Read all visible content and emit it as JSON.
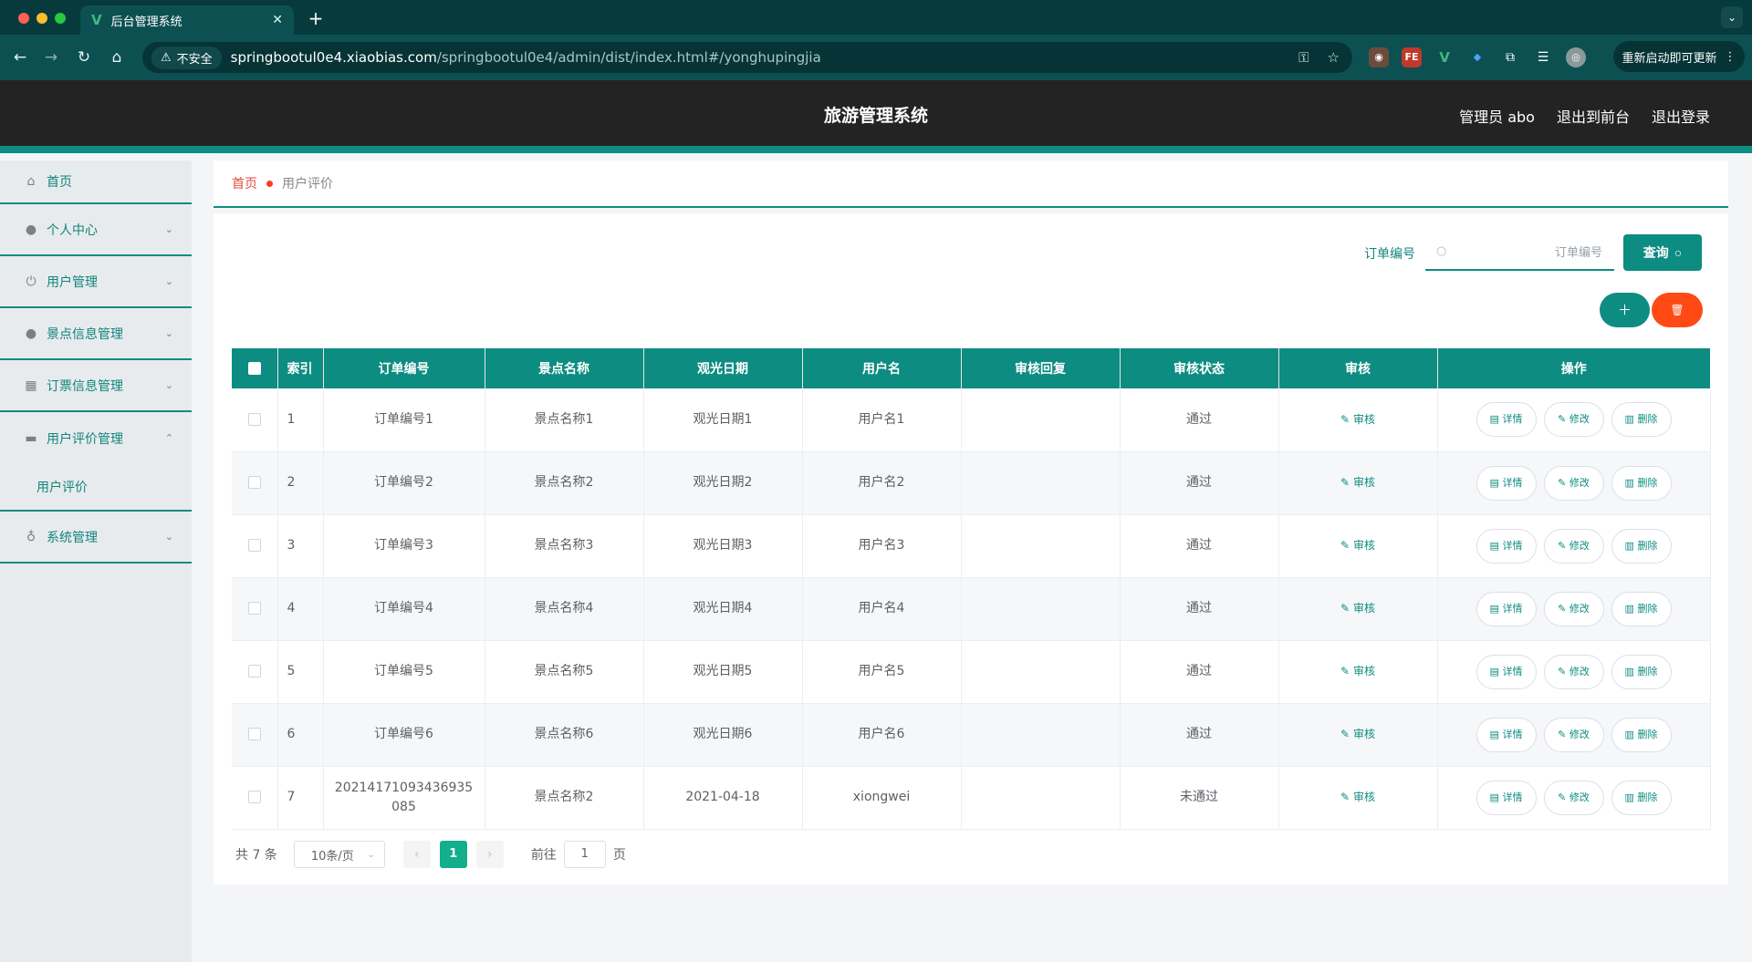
{
  "browser": {
    "tab_title": "后台管理系统",
    "url_host": "springbootul0e4.xiaobias.com",
    "url_path": "/springbootul0e4/admin/dist/index.html#/yonghupingjia",
    "security_label": "不安全",
    "relaunch_label": "重新启动即可更新"
  },
  "header": {
    "title": "旅游管理系统",
    "user_label": "管理员 abo",
    "front_link": "退出到前台",
    "logout_link": "退出登录"
  },
  "sidebar": {
    "items": [
      {
        "label": "首页",
        "icon": "home-icon"
      },
      {
        "label": "个人中心",
        "icon": "user-icon"
      },
      {
        "label": "用户管理",
        "icon": "power-icon"
      },
      {
        "label": "景点信息管理",
        "icon": "user-icon"
      },
      {
        "label": "订票信息管理",
        "icon": "grid-icon"
      },
      {
        "label": "用户评价管理",
        "icon": "printer-icon"
      },
      {
        "label": "系统管理",
        "icon": "mic-icon"
      }
    ],
    "sub_item": "用户评价"
  },
  "breadcrumb": {
    "home": "首页",
    "current": "用户评价"
  },
  "search": {
    "label": "订单编号",
    "placeholder": "订单编号",
    "button": "查询"
  },
  "table": {
    "headers": [
      "索引",
      "订单编号",
      "景点名称",
      "观光日期",
      "用户名",
      "审核回复",
      "审核状态",
      "审核",
      "操作"
    ],
    "rows": [
      {
        "index": "1",
        "order": "订单编号1",
        "spot": "景点名称1",
        "date": "观光日期1",
        "user": "用户名1",
        "reply": "",
        "status": "通过"
      },
      {
        "index": "2",
        "order": "订单编号2",
        "spot": "景点名称2",
        "date": "观光日期2",
        "user": "用户名2",
        "reply": "",
        "status": "通过"
      },
      {
        "index": "3",
        "order": "订单编号3",
        "spot": "景点名称3",
        "date": "观光日期3",
        "user": "用户名3",
        "reply": "",
        "status": "通过"
      },
      {
        "index": "4",
        "order": "订单编号4",
        "spot": "景点名称4",
        "date": "观光日期4",
        "user": "用户名4",
        "reply": "",
        "status": "通过"
      },
      {
        "index": "5",
        "order": "订单编号5",
        "spot": "景点名称5",
        "date": "观光日期5",
        "user": "用户名5",
        "reply": "",
        "status": "通过"
      },
      {
        "index": "6",
        "order": "订单编号6",
        "spot": "景点名称6",
        "date": "观光日期6",
        "user": "用户名6",
        "reply": "",
        "status": "通过"
      },
      {
        "index": "7",
        "order": "20214171093436935085",
        "spot": "景点名称2",
        "date": "2021-04-18",
        "user": "xiongwei",
        "reply": "",
        "status": "未通过"
      }
    ],
    "audit_label": "审核",
    "detail_label": "详情",
    "edit_label": "修改",
    "delete_label": "删除"
  },
  "pagination": {
    "total": "共 7 条",
    "page_size": "10条/页",
    "current_page": "1",
    "goto_label": "前往",
    "goto_value": "1",
    "page_unit": "页"
  }
}
